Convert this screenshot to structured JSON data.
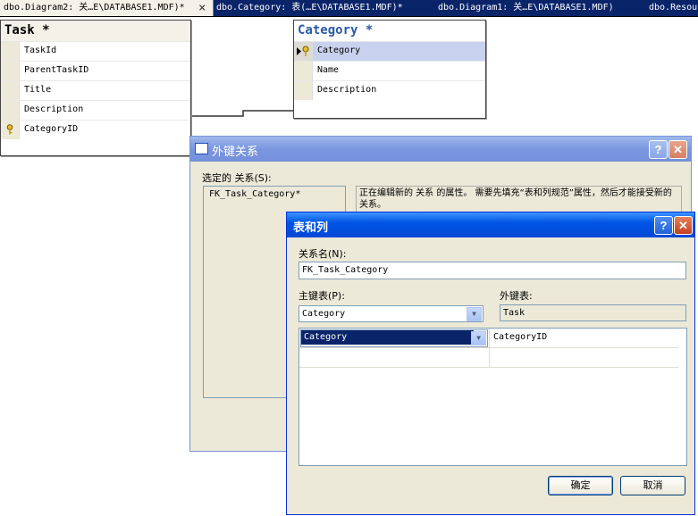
{
  "tabs": [
    {
      "label": "dbo.Diagram2: 关…E\\DATABASE1.MDF)*",
      "active": true
    },
    {
      "label": "dbo.Category: 表(…E\\DATABASE1.MDF)*",
      "active": false
    },
    {
      "label": "dbo.Diagram1: 关…E\\DATABASE1.MDF)",
      "active": false
    },
    {
      "label": "dbo.Resou",
      "active": false
    }
  ],
  "tab_close_glyph": "×",
  "task_table": {
    "title": "Task *",
    "columns": [
      "TaskId",
      "ParentTaskID",
      "Title",
      "Description",
      "CategoryID"
    ]
  },
  "category_table": {
    "title": "Category *",
    "columns": [
      "Category",
      "Name",
      "Description"
    ]
  },
  "fk_dialog": {
    "title": "外键关系",
    "selected_label": "选定的 关系(S):",
    "list_items": [
      "FK_Task_Category*"
    ],
    "description": "正在编辑新的 关系 的属性。  需要先填充“表和列规范”属性，然后才能接受新的 关系。"
  },
  "tc_dialog": {
    "title": "表和列",
    "relation_name_label": "关系名(N):",
    "relation_name_value": "FK_Task_Category",
    "pk_table_label": "主键表(P):",
    "pk_table_value": "Category",
    "fk_table_label": "外键表:",
    "fk_table_value": "Task",
    "mapping": [
      {
        "pk_column": "Category",
        "fk_column": "CategoryID"
      },
      {
        "pk_column": "",
        "fk_column": ""
      }
    ],
    "ok_label": "确定",
    "cancel_label": "取消"
  },
  "help_glyph": "?",
  "close_glyph": "✕",
  "combo_glyph": "▼",
  "icons": {
    "key": "key-icon",
    "row-selector": "arrow-key-icon"
  },
  "colors": {
    "title_blue": "#0055e5",
    "selection": "#0a246a",
    "dialog_bg": "#ece9d8"
  }
}
